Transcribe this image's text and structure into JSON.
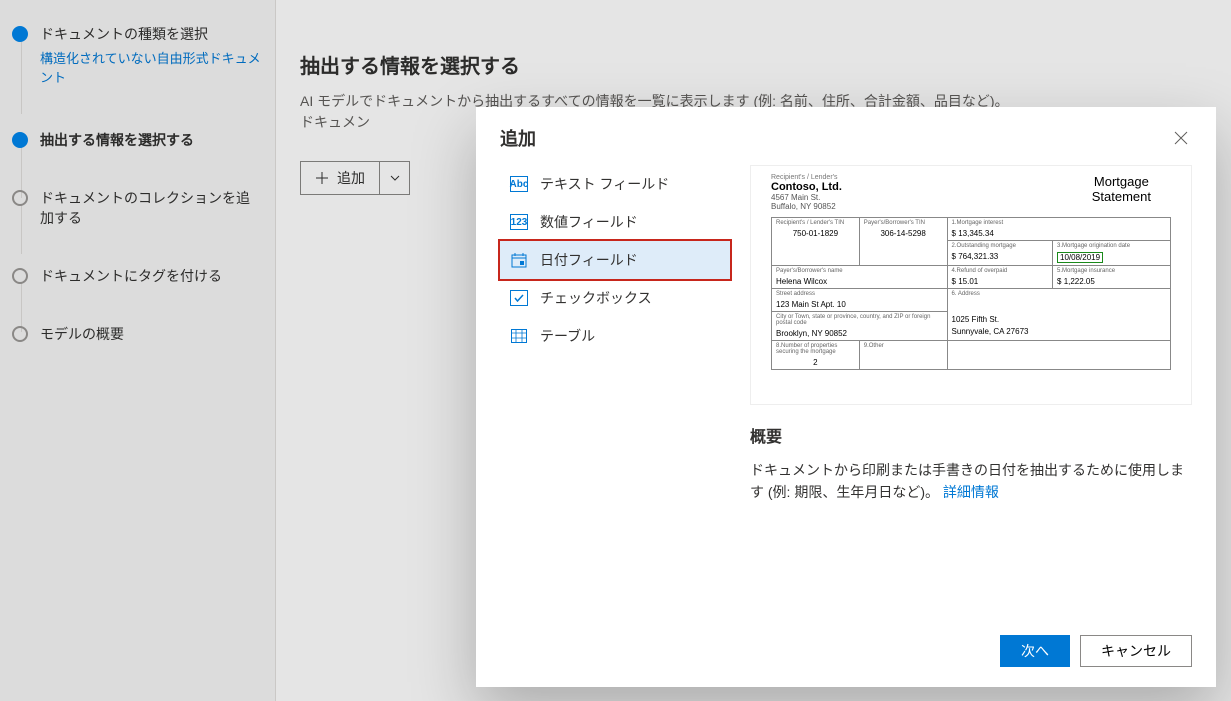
{
  "sidebar": {
    "steps": [
      {
        "label": "ドキュメントの種類を選択",
        "sub": "構造化されていない自由形式ドキュメント"
      },
      {
        "label": "抽出する情報を選択する"
      },
      {
        "label": "ドキュメントのコレクションを追加する"
      },
      {
        "label": "ドキュメントにタグを付ける"
      },
      {
        "label": "モデルの概要"
      }
    ]
  },
  "main": {
    "heading": "抽出する情報を選択する",
    "description": "AI モデルでドキュメントから抽出するすべての情報を一覧に表示します (例: 名前、住所、合計金額、品目など)。ドキュメン",
    "add_label": "追加"
  },
  "dialog": {
    "title": "追加",
    "fields": [
      {
        "icon": "text",
        "label": "テキスト フィールド"
      },
      {
        "icon": "num",
        "label": "数値フィールド"
      },
      {
        "icon": "date",
        "label": "日付フィールド"
      },
      {
        "icon": "check",
        "label": "チェックボックス"
      },
      {
        "icon": "table",
        "label": "テーブル"
      }
    ],
    "overview_heading": "概要",
    "overview_text": "ドキュメントから印刷または手書きの日付を抽出するために使用します (例: 期限、生年月日など)。",
    "more_info": "詳細情報",
    "next": "次へ",
    "cancel": "キャンセル"
  },
  "preview": {
    "recipient_label": "Recipient's / Lender's",
    "company": "Contoso, Ltd.",
    "addr1": "4567 Main St.",
    "addr2": "Buffalo, NY 90852",
    "doc_title1": "Mortgage",
    "doc_title2": "Statement",
    "cells": {
      "c1": {
        "lbl": "Recipient's / Lender's TIN",
        "val": "750-01-1829"
      },
      "c2": {
        "lbl": "Payer's/Borrower's TIN",
        "val": "306-14-5298"
      },
      "c3": {
        "lbl": "1.Mortgage interest",
        "val": "$  13,345.34"
      },
      "c4": {
        "lbl": "2.Outstanding mortgage",
        "val": "$  764,321.33"
      },
      "c5": {
        "lbl": "3.Mortgage origination date",
        "val": "10/08/2019"
      },
      "c6": {
        "lbl": "Payer's/Borrower's name",
        "val": "Helena Wilcox"
      },
      "c7": {
        "lbl": "4.Refund of overpaid",
        "val": "$    15.01"
      },
      "c8": {
        "lbl": "5.Mortgage insurance",
        "val": "$  1,222.05"
      },
      "c9": {
        "lbl": "Street address",
        "val": "123 Main St Apt. 10"
      },
      "c10": {
        "lbl": "6. Address",
        "val": ""
      },
      "c11": {
        "lbl": "City or Town, state or province, country, and ZIP or foreign postal code",
        "val": "Brooklyn, NY 90852"
      },
      "c12a": "1025 Fifth St.",
      "c12b": "Sunnyvale, CA 27673",
      "c13": {
        "lbl": "8.Number of properties securing the mortgage",
        "val": "2"
      },
      "c14": {
        "lbl": "9.Other",
        "val": ""
      }
    }
  }
}
